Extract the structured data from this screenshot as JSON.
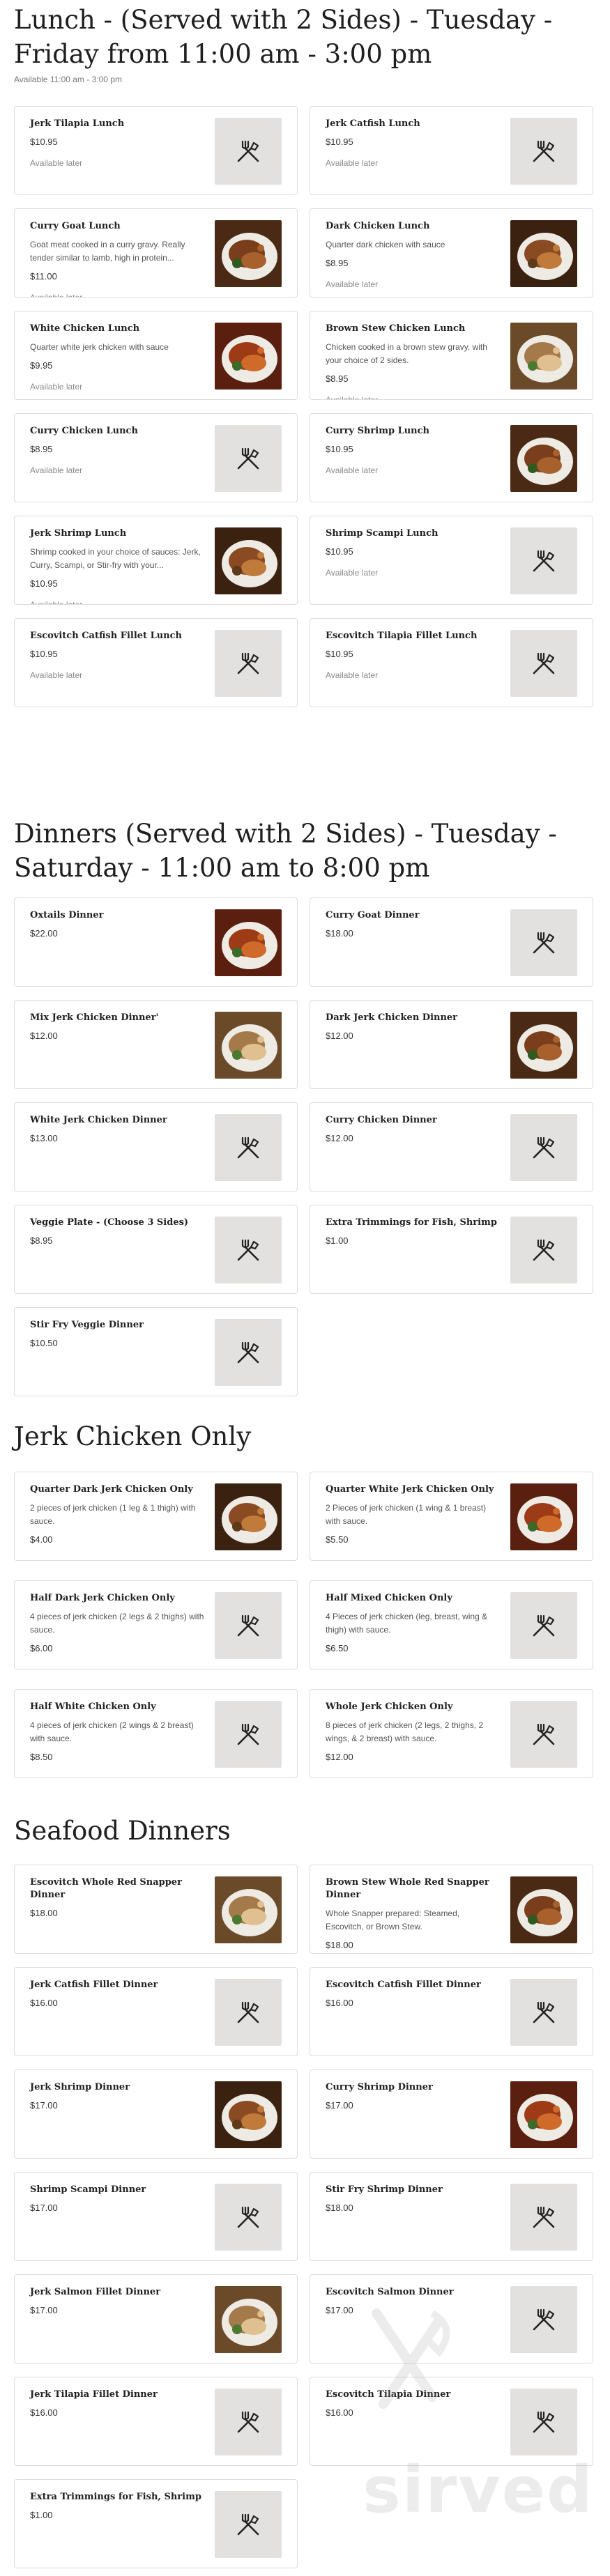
{
  "lunch": {
    "title": "Lunch - (Served with 2 Sides) - Tuesday - Friday from 11:00 am - 3:00 pm",
    "subtitle": "Available 11:00 am - 3:00 pm",
    "items": [
      {
        "name": "Jerk Tilapia Lunch",
        "desc": "",
        "price": "$10.95",
        "avail": "Available later",
        "photo": false
      },
      {
        "name": "Jerk Catfish Lunch",
        "desc": "",
        "price": "$10.95",
        "avail": "Available later",
        "photo": false
      },
      {
        "name": "Curry Goat Lunch",
        "desc": "Goat meat cooked in a curry gravy. Really tender similar to lamb, high in protein...",
        "price": "$11.00",
        "avail": "Available later",
        "photo": true
      },
      {
        "name": "Dark Chicken Lunch",
        "desc": "Quarter dark chicken with sauce",
        "price": "$8.95",
        "avail": "Available later",
        "photo": true
      },
      {
        "name": "White Chicken Lunch",
        "desc": "Quarter white jerk chicken with sauce",
        "price": "$9.95",
        "avail": "Available later",
        "photo": true
      },
      {
        "name": "Brown Stew Chicken Lunch",
        "desc": "Chicken cooked in a brown stew gravy, with your choice of 2 sides.",
        "price": "$8.95",
        "avail": "Available later",
        "photo": true
      },
      {
        "name": "Curry Chicken Lunch",
        "desc": "",
        "price": "$8.95",
        "avail": "Available later",
        "photo": false
      },
      {
        "name": "Curry Shrimp Lunch",
        "desc": "",
        "price": "$10.95",
        "avail": "Available later",
        "photo": true
      },
      {
        "name": "Jerk Shrimp Lunch",
        "desc": "Shrimp cooked in your choice of sauces: Jerk, Curry, Scampi, or Stir-fry with your...",
        "price": "$10.95",
        "avail": "Available later",
        "photo": true
      },
      {
        "name": "Shrimp Scampi Lunch",
        "desc": "",
        "price": "$10.95",
        "avail": "Available later",
        "photo": false
      },
      {
        "name": "Escovitch Catfish Fillet Lunch",
        "desc": "",
        "price": "$10.95",
        "avail": "Available later",
        "photo": false
      },
      {
        "name": "Escovitch Tilapia Fillet Lunch",
        "desc": "",
        "price": "$10.95",
        "avail": "Available later",
        "photo": false
      }
    ]
  },
  "dinners": {
    "title": "Dinners (Served with 2 Sides) - Tuesday - Saturday - 11:00 am to 8:00 pm",
    "items": [
      {
        "name": "Oxtails Dinner",
        "desc": "",
        "price": "$22.00",
        "photo": true
      },
      {
        "name": "Curry Goat Dinner",
        "desc": "",
        "price": "$18.00",
        "photo": false
      },
      {
        "name": "Mix Jerk Chicken Dinner'",
        "desc": "",
        "price": "$12.00",
        "photo": true
      },
      {
        "name": "Dark Jerk Chicken Dinner",
        "desc": "",
        "price": "$12.00",
        "photo": true
      },
      {
        "name": "White Jerk Chicken Dinner",
        "desc": "",
        "price": "$13.00",
        "photo": false
      },
      {
        "name": "Curry Chicken Dinner",
        "desc": "",
        "price": "$12.00",
        "photo": false
      },
      {
        "name": "Veggie Plate - (Choose 3 Sides)",
        "desc": "",
        "price": "$8.95",
        "photo": false
      },
      {
        "name": "Extra Trimmings for Fish, Shrimp",
        "desc": "",
        "price": "$1.00",
        "photo": false
      },
      {
        "name": "Stir Fry Veggie Dinner",
        "desc": "",
        "price": "$10.50",
        "photo": false
      }
    ]
  },
  "jerk": {
    "title": "Jerk Chicken Only",
    "items": [
      {
        "name": "Quarter Dark Jerk Chicken Only",
        "desc": "2 pieces of jerk chicken (1 leg & 1 thigh) with sauce.",
        "price": "$4.00",
        "photo": true
      },
      {
        "name": "Quarter White Jerk Chicken Only",
        "desc": "2 Pieces of jerk chicken (1 wing & 1 breast) with sauce.",
        "price": "$5.50",
        "photo": true
      },
      {
        "name": "Half Dark Jerk Chicken Only",
        "desc": "4 pieces of jerk chicken (2 legs & 2 thighs) with sauce.",
        "price": "$6.00",
        "photo": false
      },
      {
        "name": "Half Mixed Chicken Only",
        "desc": "4 Pieces of jerk chicken (leg, breast, wing & thigh) with sauce.",
        "price": "$6.50",
        "photo": false
      },
      {
        "name": "Half White Chicken Only",
        "desc": "4 pieces of jerk chicken (2 wings & 2 breast) with sauce.",
        "price": "$8.50",
        "photo": false
      },
      {
        "name": "Whole Jerk Chicken Only",
        "desc": "8 pieces of jerk chicken (2 legs, 2 thighs, 2 wings, & 2 breast) with sauce.",
        "price": "$12.00",
        "photo": false
      }
    ]
  },
  "seafood": {
    "title": "Seafood Dinners",
    "items": [
      {
        "name": "Escovitch Whole Red Snapper Dinner",
        "desc": "",
        "price": "$18.00",
        "photo": true
      },
      {
        "name": "Brown Stew Whole Red Snapper Dinner",
        "desc": "Whole Snapper prepared: Steamed, Escovitch, or Brown Stew.",
        "price": "$18.00",
        "photo": true
      },
      {
        "name": "Jerk Catfish Fillet Dinner",
        "desc": "",
        "price": "$16.00",
        "photo": false
      },
      {
        "name": "Escovitch Catfish Fillet Dinner",
        "desc": "",
        "price": "$16.00",
        "photo": false
      },
      {
        "name": "Jerk Shrimp Dinner",
        "desc": "",
        "price": "$17.00",
        "photo": true
      },
      {
        "name": "Curry Shrimp Dinner",
        "desc": "",
        "price": "$17.00",
        "photo": true
      },
      {
        "name": "Shrimp Scampi Dinner",
        "desc": "",
        "price": "$17.00",
        "photo": false
      },
      {
        "name": "Stir Fry Shrimp Dinner",
        "desc": "",
        "price": "$18.00",
        "photo": false
      },
      {
        "name": "Jerk Salmon Fillet Dinner",
        "desc": "",
        "price": "$17.00",
        "photo": true
      },
      {
        "name": "Escovitch Salmon Dinner",
        "desc": "",
        "price": "$17.00",
        "photo": false
      },
      {
        "name": "Jerk Tilapia Fillet Dinner",
        "desc": "",
        "price": "$16.00",
        "photo": false
      },
      {
        "name": "Escovitch Tilapia Dinner",
        "desc": "",
        "price": "$16.00",
        "photo": false
      },
      {
        "name": "Extra Trimmings for Fish, Shrimp",
        "desc": "",
        "price": "$1.00",
        "photo": false
      }
    ]
  },
  "watermark": {
    "text": "sirved"
  },
  "colors": {
    "placeholder_bg": "#e3e1df",
    "card_border": "#dcdcdc",
    "muted_text": "#8a8a8a"
  }
}
